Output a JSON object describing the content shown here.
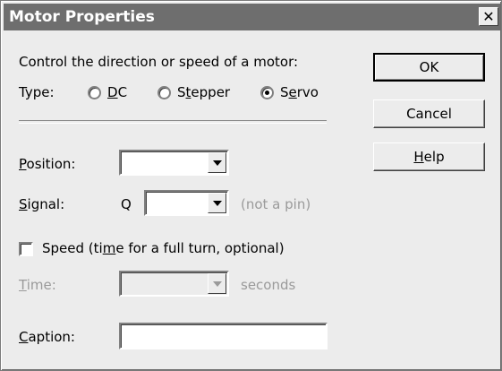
{
  "window": {
    "title": "Motor Properties",
    "close_glyph": "✕"
  },
  "intro": "Control the direction or speed of a motor:",
  "type": {
    "label": "Type:",
    "options": [
      {
        "prefix": "",
        "accel": "D",
        "suffix": "C",
        "selected": false
      },
      {
        "prefix": "S",
        "accel": "t",
        "suffix": "epper",
        "selected": false
      },
      {
        "prefix": "S",
        "accel": "e",
        "suffix": "rvo",
        "selected": true
      }
    ]
  },
  "position": {
    "accel": "P",
    "rest": "osition:",
    "value": ""
  },
  "signal": {
    "accel": "S",
    "rest": "ignal:",
    "prefix": "Q",
    "value": "",
    "hint": "(not a pin)"
  },
  "speed": {
    "pre": "Speed (ti",
    "accel": "m",
    "post": "e for a full turn, optional)",
    "checked": false
  },
  "time": {
    "accel": "T",
    "rest": "ime:",
    "value": "",
    "unit": "seconds",
    "enabled": false
  },
  "caption": {
    "accel": "C",
    "rest": "aption:",
    "value": ""
  },
  "buttons": {
    "ok": "OK",
    "cancel": "Cancel",
    "help": {
      "accel": "H",
      "rest": "elp"
    }
  },
  "colors": {
    "titlebar": "#6e6e6e",
    "face": "#ececec",
    "disabled_text": "#9a9a9a"
  }
}
